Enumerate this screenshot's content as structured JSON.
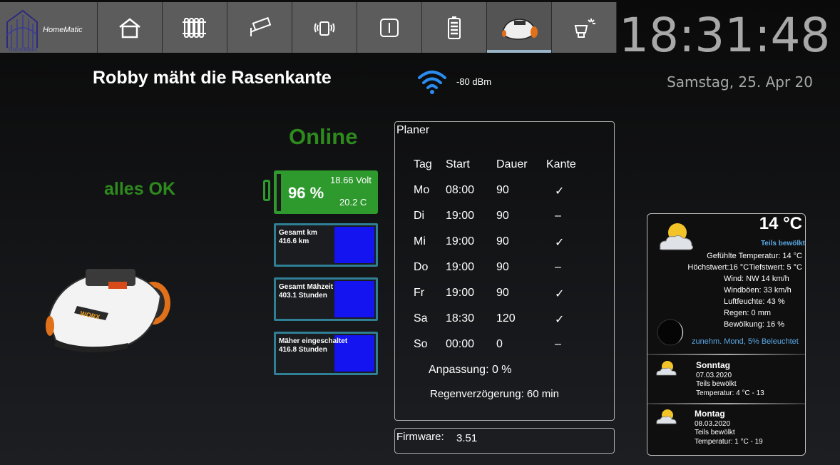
{
  "nav": {
    "logo_text": "HomeMatic",
    "logo_sub": "HomeMatic",
    "items": [
      "home-icon",
      "radiator-icon",
      "camera-icon",
      "phone-icon",
      "switch-icon",
      "battery-icon",
      "mower-icon",
      "light-icon"
    ],
    "active_index": 6
  },
  "clock": {
    "time": "18:31:48",
    "date": "Samstag, 25. Apr 20"
  },
  "header": {
    "title": "Robby mäht die Rasenkante",
    "signal": "-80 dBm"
  },
  "mower": {
    "online": "Online",
    "status": "alles OK",
    "battery_pct": "96 %",
    "battery_volt": "18.66 Volt",
    "battery_temp": "20.2 C",
    "stats": [
      {
        "label": "Gesamt km",
        "value": "416.6 km"
      },
      {
        "label": "Gesamt Mähzeit",
        "value": "403.1 Stunden"
      },
      {
        "label": "Mäher eingeschaltet",
        "value": "416.8 Stunden"
      }
    ]
  },
  "planer": {
    "title": "Planer",
    "headers": [
      "Tag",
      "Start",
      "Dauer",
      "Kante"
    ],
    "rows": [
      [
        "Mo",
        "08:00",
        "90",
        "✓"
      ],
      [
        "Di",
        "19:00",
        "90",
        "–"
      ],
      [
        "Mi",
        "19:00",
        "90",
        "✓"
      ],
      [
        "Do",
        "19:00",
        "90",
        "–"
      ],
      [
        "Fr",
        "19:00",
        "90",
        "✓"
      ],
      [
        "Sa",
        "18:30",
        "120",
        "✓"
      ],
      [
        "So",
        "00:00",
        "0",
        "–"
      ]
    ],
    "adjust": "Anpassung: 0 %",
    "rain_delay": "Regenverzögerung: 60 min"
  },
  "firmware": {
    "label": "Firmware:",
    "value": "3.51"
  },
  "weather": {
    "temp": "14 °C",
    "condition": "Teils bewölkt",
    "rows": [
      "Gefühlte Temperatur: 14 °C",
      "Höchstwert:16 °CTiefstwert:  5 °C",
      "Wind:  NW  14 km/h",
      "Windböen:     33 km/h",
      "Luftfeuchte:       43 %",
      "Regen:          0 mm",
      "Bewölkung:       16 %"
    ],
    "moon": "zunehm. Mond, 5% Beleuchtet",
    "forecast": [
      {
        "day": "Sonntag",
        "date": "07.03.2020",
        "cond": "Teils bewölkt",
        "temp": "Temperatur: 4 °C  -     13"
      },
      {
        "day": "Montag",
        "date": "08.03.2020",
        "cond": "Teils bewölkt",
        "temp": "Temperatur: 1 °C  -     19"
      }
    ]
  }
}
